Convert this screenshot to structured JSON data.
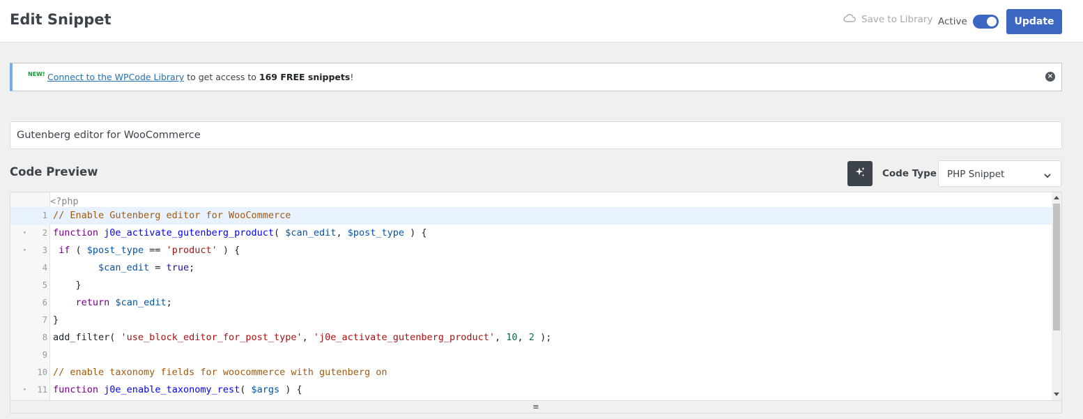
{
  "header": {
    "title": "Edit Snippet",
    "save_to_library": "Save to Library",
    "active_label": "Active",
    "active": true,
    "update_label": "Update"
  },
  "notice": {
    "badge": "NEW!",
    "link_text": "Connect to the WPCode Library",
    "text_middle": " to get access to ",
    "bold_text": "169 FREE snippets",
    "text_end": "!"
  },
  "snippet": {
    "title_value": "Gutenberg editor for WooCommerce"
  },
  "code_preview": {
    "title": "Code Preview",
    "code_type_label": "Code Type",
    "code_type_value": "PHP Snippet"
  },
  "editor": {
    "php_open": "<?php",
    "resize_handle": "≡",
    "lines": [
      {
        "num": "1",
        "fold": false,
        "current": true,
        "tokens": [
          [
            "cm",
            "// Enable Gutenberg editor for WooCommerce"
          ]
        ]
      },
      {
        "num": "2",
        "fold": true,
        "current": false,
        "tokens": [
          [
            "kw",
            "function"
          ],
          [
            "",
            " "
          ],
          [
            "def",
            "j0e_activate_gutenberg_product"
          ],
          [
            "",
            "( "
          ],
          [
            "var",
            "$can_edit"
          ],
          [
            "",
            ", "
          ],
          [
            "var",
            "$post_type"
          ],
          [
            "",
            " ) {"
          ]
        ]
      },
      {
        "num": "3",
        "fold": true,
        "current": false,
        "tokens": [
          [
            "",
            " "
          ],
          [
            "kw",
            "if"
          ],
          [
            "",
            " ( "
          ],
          [
            "var",
            "$post_type"
          ],
          [
            "",
            " == "
          ],
          [
            "str",
            "'product'"
          ],
          [
            "",
            " ) {"
          ]
        ]
      },
      {
        "num": "4",
        "fold": false,
        "current": false,
        "tokens": [
          [
            "",
            "        "
          ],
          [
            "var",
            "$can_edit"
          ],
          [
            "",
            " = "
          ],
          [
            "atom",
            "true"
          ],
          [
            "",
            ";"
          ]
        ]
      },
      {
        "num": "5",
        "fold": false,
        "current": false,
        "tokens": [
          [
            "",
            "    }"
          ]
        ]
      },
      {
        "num": "6",
        "fold": false,
        "current": false,
        "tokens": [
          [
            "",
            "    "
          ],
          [
            "kw",
            "return"
          ],
          [
            "",
            " "
          ],
          [
            "var",
            "$can_edit"
          ],
          [
            "",
            ";"
          ]
        ]
      },
      {
        "num": "7",
        "fold": false,
        "current": false,
        "tokens": [
          [
            "",
            "}"
          ]
        ]
      },
      {
        "num": "8",
        "fold": false,
        "current": false,
        "tokens": [
          [
            "",
            "add_filter( "
          ],
          [
            "str",
            "'use_block_editor_for_post_type'"
          ],
          [
            "",
            ", "
          ],
          [
            "str",
            "'j0e_activate_gutenberg_product'"
          ],
          [
            "",
            ", "
          ],
          [
            "num",
            "10"
          ],
          [
            "",
            ", "
          ],
          [
            "num",
            "2"
          ],
          [
            "",
            " );"
          ]
        ]
      },
      {
        "num": "9",
        "fold": false,
        "current": false,
        "tokens": []
      },
      {
        "num": "10",
        "fold": false,
        "current": false,
        "tokens": [
          [
            "cm",
            "// enable taxonomy fields for woocommerce with gutenberg on"
          ]
        ]
      },
      {
        "num": "11",
        "fold": true,
        "current": false,
        "tokens": [
          [
            "kw",
            "function"
          ],
          [
            "",
            " "
          ],
          [
            "def",
            "j0e_enable_taxonomy_rest"
          ],
          [
            "",
            "( "
          ],
          [
            "var",
            "$args"
          ],
          [
            "",
            " ) {"
          ]
        ]
      }
    ]
  },
  "colors": {
    "accent": "#3b67c3",
    "notice_border": "#72aee6",
    "new_badge": "#00a32a",
    "current_line": "#e8f2ff"
  },
  "icons": {
    "cloud": "cloud-icon",
    "ai": "sparkle-icon",
    "close": "close-circle-icon",
    "chevron": "chevron-down-icon"
  }
}
